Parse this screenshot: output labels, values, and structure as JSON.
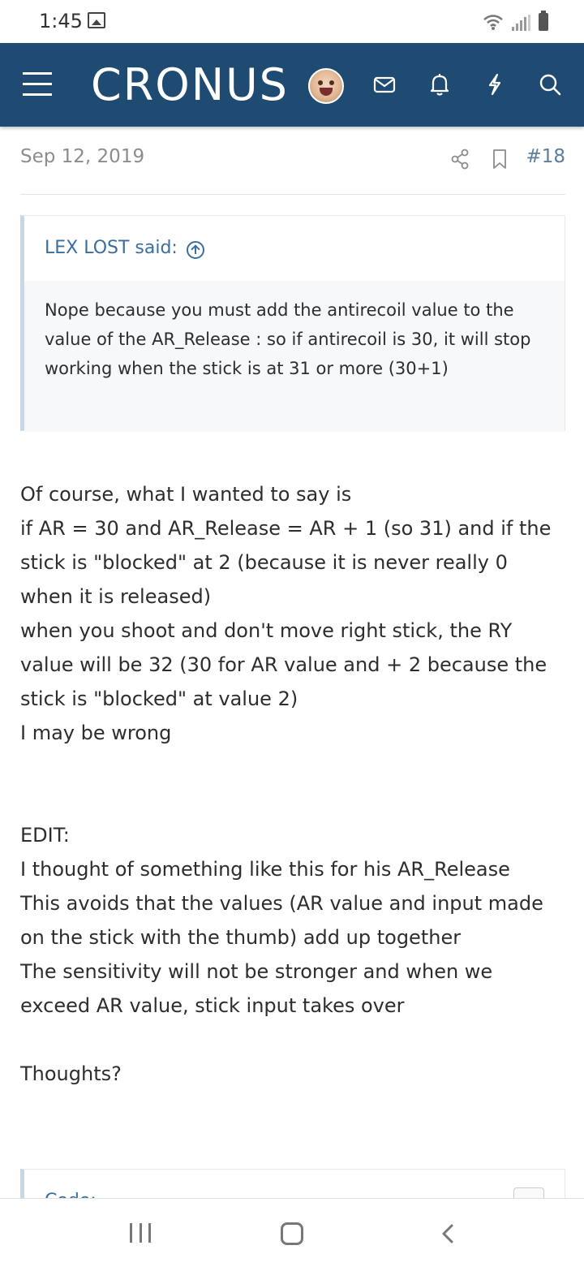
{
  "status_bar": {
    "time": "1:45"
  },
  "app_bar": {
    "logo_text": "CRONUS",
    "brand_color": "#1f4a72",
    "icons": [
      "menu-icon",
      "avatar",
      "mail-icon",
      "bell-icon",
      "bolt-icon",
      "search-icon"
    ]
  },
  "post": {
    "date": "Sep 12, 2019",
    "number": "#18",
    "quote": {
      "author": "LEX LOST said:",
      "text": "Nope because you must add the antirecoil value to the value of the AR_Release : so if antirecoil is 30, it will stop working when the stick is at 31 or more (30+1)"
    },
    "body_paragraph_1": "Of course, what I wanted to say is\nif AR = 30 and AR_Release = AR + 1 (so 31) and if the stick is \"blocked\" at 2 (because it is never really 0 when it is released)\nwhen you shoot and don't move right stick, the RY value will be 32 (30 for AR value and + 2 because the stick is \"blocked\" at value 2)\nI may be wrong",
    "body_paragraph_2": "EDIT:\nI thought of something like this for his AR_Release\nThis avoids that the values (AR value and input made on the stick with the thumb) add up together\nThe sensitivity will not be stronger and when we exceed AR value, stick input takes over",
    "body_paragraph_3": "Thoughts?",
    "next_quote_author": "Code:"
  }
}
